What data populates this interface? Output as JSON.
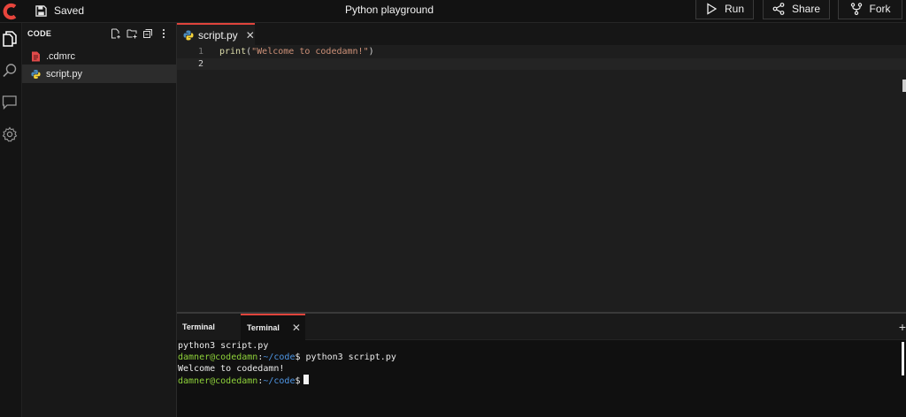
{
  "topbar": {
    "logo_letter": "C",
    "saved_label": "Saved",
    "title": "Python playground",
    "run_label": "Run",
    "share_label": "Share",
    "fork_label": "Fork"
  },
  "activity": {
    "icons": [
      "files-icon",
      "search-icon",
      "chat-icon",
      "settings-icon"
    ]
  },
  "sidebar": {
    "header": "CODE",
    "actions": [
      "new-file-icon",
      "new-folder-icon",
      "collapse-icon",
      "more-icon"
    ],
    "files": [
      {
        "name": ".cdmrc",
        "icon": "config-file-icon",
        "active": false
      },
      {
        "name": "script.py",
        "icon": "python-icon",
        "active": true
      }
    ]
  },
  "editor": {
    "tab_label": "script.py",
    "tab_close": "✕",
    "lines": [
      {
        "number": "1",
        "fn": "print",
        "open": "(",
        "str": "\"Welcome to codedamn!\"",
        "close": ")"
      },
      {
        "number": "2"
      }
    ]
  },
  "terminal": {
    "tabs": [
      "Terminal",
      "Terminal"
    ],
    "tab_close": "✕",
    "plus": "+",
    "line1": "python3 script.py",
    "line2_user": "damner@codedamn",
    "line2_sep": ":",
    "line2_path": "~/code",
    "line2_cmd": "$ python3 script.py",
    "line3": "Welcome to codedamn!",
    "line4_user": "damner@codedamn",
    "line4_sep": ":",
    "line4_path": "~/code",
    "line4_cmd": "$"
  },
  "colors": {
    "accent": "#e0443c",
    "prompt_user": "#8fd33a",
    "prompt_path": "#4f97e6",
    "string": "#ce9178",
    "function": "#dcdcaa"
  }
}
